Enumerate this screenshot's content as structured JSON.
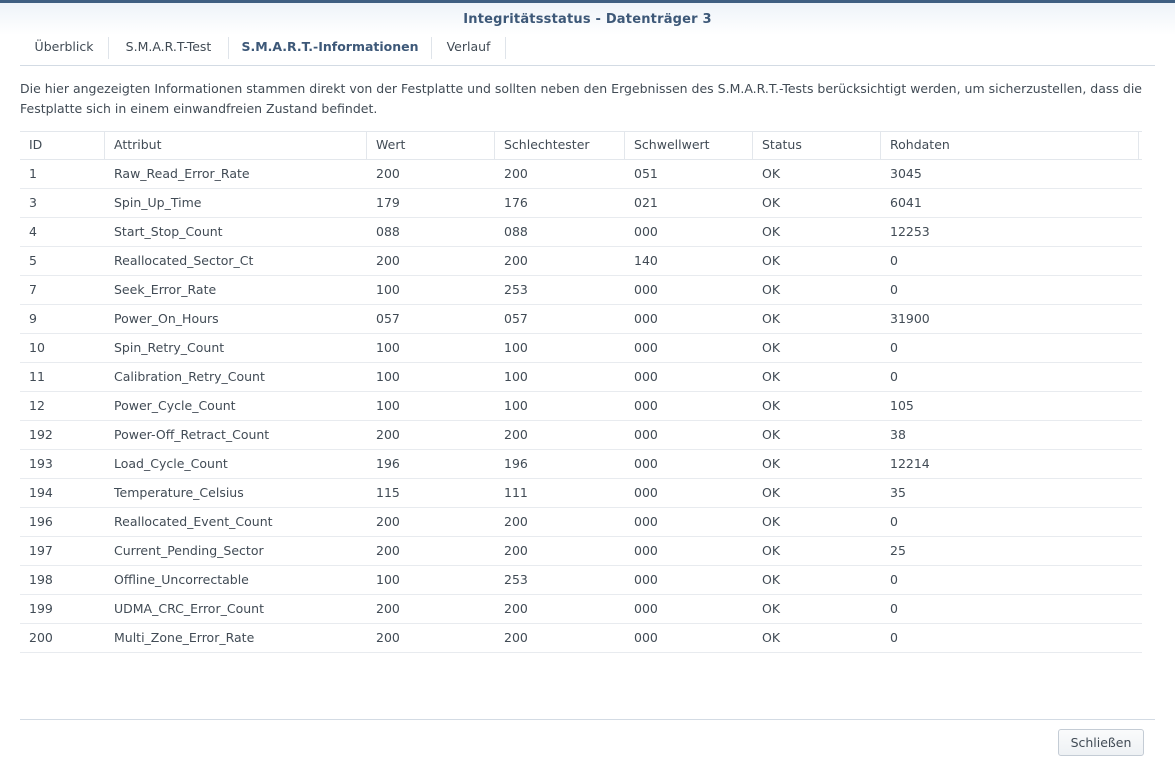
{
  "window": {
    "title": "Integritätsstatus - Datenträger 3"
  },
  "tabs": [
    {
      "label": "Überblick"
    },
    {
      "label": "S.M.A.R.T-Test"
    },
    {
      "label": "S.M.A.R.T.-Informationen"
    },
    {
      "label": "Verlauf"
    }
  ],
  "active_tab": "S.M.A.R.T.-Informationen",
  "description": "Die hier angezeigten Informationen stammen direkt von der Festplatte und sollten neben den Ergebnissen des S.M.A.R.T.-Tests berücksichtigt werden, um sicherzustellen, dass die Festplatte sich in einem einwandfreien Zustand befindet.",
  "table": {
    "columns": [
      "ID",
      "Attribut",
      "Wert",
      "Schlechtester",
      "Schwellwert",
      "Status",
      "Rohdaten"
    ],
    "rows": [
      [
        "1",
        "Raw_Read_Error_Rate",
        "200",
        "200",
        "051",
        "OK",
        "3045"
      ],
      [
        "3",
        "Spin_Up_Time",
        "179",
        "176",
        "021",
        "OK",
        "6041"
      ],
      [
        "4",
        "Start_Stop_Count",
        "088",
        "088",
        "000",
        "OK",
        "12253"
      ],
      [
        "5",
        "Reallocated_Sector_Ct",
        "200",
        "200",
        "140",
        "OK",
        "0"
      ],
      [
        "7",
        "Seek_Error_Rate",
        "100",
        "253",
        "000",
        "OK",
        "0"
      ],
      [
        "9",
        "Power_On_Hours",
        "057",
        "057",
        "000",
        "OK",
        "31900"
      ],
      [
        "10",
        "Spin_Retry_Count",
        "100",
        "100",
        "000",
        "OK",
        "0"
      ],
      [
        "11",
        "Calibration_Retry_Count",
        "100",
        "100",
        "000",
        "OK",
        "0"
      ],
      [
        "12",
        "Power_Cycle_Count",
        "100",
        "100",
        "000",
        "OK",
        "105"
      ],
      [
        "192",
        "Power-Off_Retract_Count",
        "200",
        "200",
        "000",
        "OK",
        "38"
      ],
      [
        "193",
        "Load_Cycle_Count",
        "196",
        "196",
        "000",
        "OK",
        "12214"
      ],
      [
        "194",
        "Temperature_Celsius",
        "115",
        "111",
        "000",
        "OK",
        "35"
      ],
      [
        "196",
        "Reallocated_Event_Count",
        "200",
        "200",
        "000",
        "OK",
        "0"
      ],
      [
        "197",
        "Current_Pending_Sector",
        "200",
        "200",
        "000",
        "OK",
        "25"
      ],
      [
        "198",
        "Offline_Uncorrectable",
        "100",
        "253",
        "000",
        "OK",
        "0"
      ],
      [
        "199",
        "UDMA_CRC_Error_Count",
        "200",
        "200",
        "000",
        "OK",
        "0"
      ],
      [
        "200",
        "Multi_Zone_Error_Rate",
        "200",
        "200",
        "000",
        "OK",
        "0"
      ]
    ]
  },
  "footer": {
    "close_label": "Schließen"
  },
  "colors": {
    "accent": "#3d5878",
    "topline": "#3f5f82",
    "text": "#414b55",
    "border": "#e3e7ec"
  }
}
